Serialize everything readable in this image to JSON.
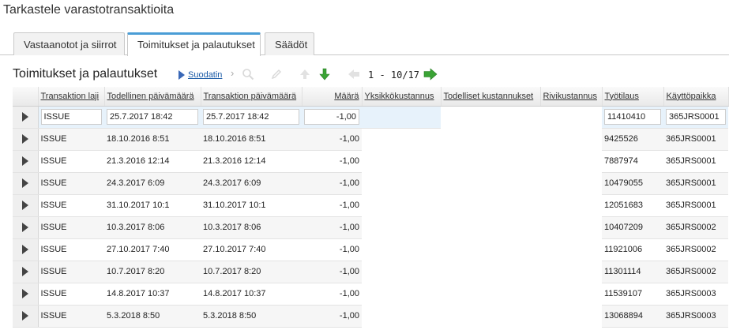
{
  "page": {
    "title": "Tarkastele varastotransaktioita"
  },
  "tabs": [
    {
      "label": "Vastaanotot ja siirrot"
    },
    {
      "label": "Toimitukset ja palautukset"
    },
    {
      "label": "Säädöt"
    }
  ],
  "section": {
    "title": "Toimitukset ja palautukset"
  },
  "toolbar": {
    "filter_label": "Suodatin",
    "chevron": "›",
    "range": "1 - 10/17"
  },
  "columns": {
    "tyyppi": "Transaktion laji",
    "todellinen_pvm": "Todellinen päivämäärä",
    "transaktio_pvm": "Transaktion päivämäärä",
    "maara": "Määrä",
    "yksikkokustannus": "Yksikkökustannus",
    "todelliset_kustannukset": "Todelliset kustannukset",
    "rivikustannus": "Rivikustannus",
    "tyotilaus": "Työtilaus",
    "kayttopaikka": "Käyttöpaikka"
  },
  "rows": [
    {
      "tyyppi": "ISSUE",
      "todellinen_pvm": "25.7.2017 18:42",
      "transaktio_pvm": "25.7.2017 18:42",
      "maara": "-1,00",
      "tyotilaus": "11410410",
      "kayttopaikka": "365JRS0001"
    },
    {
      "tyyppi": "ISSUE",
      "todellinen_pvm": "18.10.2016 8:51",
      "transaktio_pvm": "18.10.2016 8:51",
      "maara": "-1,00",
      "tyotilaus": "9425526",
      "kayttopaikka": "365JRS0001"
    },
    {
      "tyyppi": "ISSUE",
      "todellinen_pvm": "21.3.2016 12:14",
      "transaktio_pvm": "21.3.2016 12:14",
      "maara": "-1,00",
      "tyotilaus": "7887974",
      "kayttopaikka": "365JRS0001"
    },
    {
      "tyyppi": "ISSUE",
      "todellinen_pvm": "24.3.2017 6:09",
      "transaktio_pvm": "24.3.2017 6:09",
      "maara": "-1,00",
      "tyotilaus": "10479055",
      "kayttopaikka": "365JRS0001"
    },
    {
      "tyyppi": "ISSUE",
      "todellinen_pvm": "31.10.2017 10:1",
      "transaktio_pvm": "31.10.2017 10:1",
      "maara": "-1,00",
      "tyotilaus": "12051683",
      "kayttopaikka": "365JRS0001"
    },
    {
      "tyyppi": "ISSUE",
      "todellinen_pvm": "10.3.2017 8:06",
      "transaktio_pvm": "10.3.2017 8:06",
      "maara": "-1,00",
      "tyotilaus": "10407209",
      "kayttopaikka": "365JRS0002"
    },
    {
      "tyyppi": "ISSUE",
      "todellinen_pvm": "27.10.2017 7:40",
      "transaktio_pvm": "27.10.2017 7:40",
      "maara": "-1,00",
      "tyotilaus": "11921006",
      "kayttopaikka": "365JRS0002"
    },
    {
      "tyyppi": "ISSUE",
      "todellinen_pvm": "10.7.2017 8:20",
      "transaktio_pvm": "10.7.2017 8:20",
      "maara": "-1,00",
      "tyotilaus": "11301114",
      "kayttopaikka": "365JRS0002"
    },
    {
      "tyyppi": "ISSUE",
      "todellinen_pvm": "14.8.2017 10:37",
      "transaktio_pvm": "14.8.2017 10:37",
      "maara": "-1,00",
      "tyotilaus": "11539107",
      "kayttopaikka": "365JRS0003"
    },
    {
      "tyyppi": "ISSUE",
      "todellinen_pvm": "5.3.2018 8:50",
      "transaktio_pvm": "5.3.2018 8:50",
      "maara": "-1,00",
      "tyotilaus": "13068894",
      "kayttopaikka": "365JRS0003"
    }
  ],
  "icons": {
    "filter": "play-triangle-icon",
    "search": "search-icon",
    "edit": "pencil-icon",
    "up": "arrow-up-icon",
    "down": "arrow-down-icon",
    "prev": "arrow-left-icon",
    "next": "arrow-right-icon",
    "row": "row-selector-icon"
  },
  "colors": {
    "accent": "#4a9dd6",
    "link": "#1a5aa6",
    "arrow_green": "#3aa335",
    "selected_row": "#e7f2fb"
  }
}
